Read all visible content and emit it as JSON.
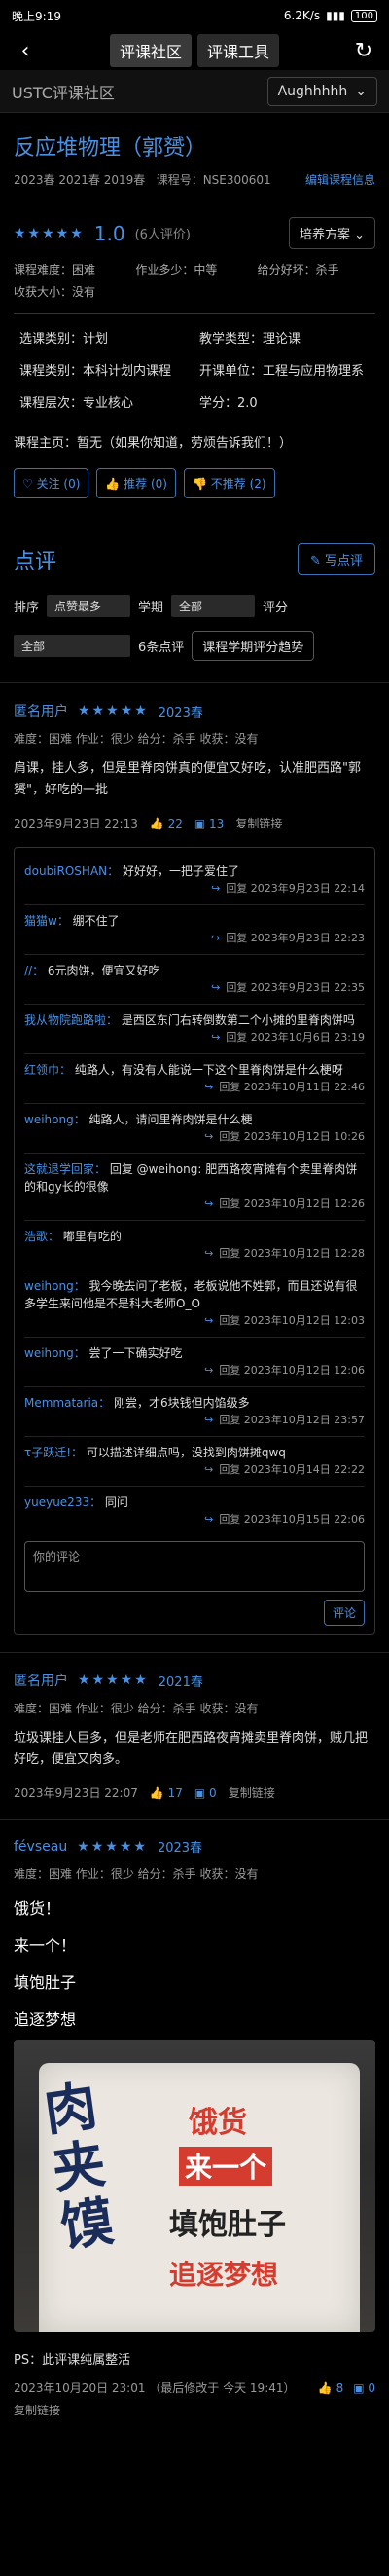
{
  "status": {
    "time": "晚上9:19",
    "speed": "6.2K/s",
    "battery": "100"
  },
  "nav": {
    "tabs": [
      "评课社区",
      "评课工具"
    ],
    "back": "‹",
    "refresh": "↻"
  },
  "site": {
    "title": "USTC评课社区",
    "user": "Aughhhhh"
  },
  "course": {
    "title": "反应堆物理（郭赟）",
    "terms": "2023春 2021春 2019春",
    "code": "课程号：NSE300601",
    "edit": "编辑课程信息",
    "stars": "★★★★★",
    "score": "1.0",
    "count": "(6人评价)",
    "plan": "培养方案",
    "info": [
      "课程难度：困难",
      "作业多少：中等",
      "给分好坏：杀手",
      "收获大小：没有"
    ],
    "details": [
      "选课类别：计划",
      "教学类型：理论课",
      "课程类别：本科计划内课程",
      "开课单位：工程与应用物理系",
      "课程层次：专业核心",
      "学分：2.0"
    ],
    "homepage": "课程主页：暂无（如果你知道，劳烦告诉我们！）",
    "actions": [
      "关注 (0)",
      "推荐 (0)",
      "不推荐 (2)"
    ]
  },
  "reviews_header": {
    "title": "点评",
    "write": "写点评",
    "sort_label": "排序",
    "sort_value": "点赞最多",
    "term_label": "学期",
    "term_value": "全部",
    "score_label": "评分",
    "score_value": "全部",
    "count": "6条点评",
    "trend": "课程学期评分趋势"
  },
  "reviews": [
    {
      "name": "匿名用户",
      "stars": "★★★★★",
      "semester": "2023春",
      "meta": "难度：困难   作业：很少   给分：杀手   收获：没有",
      "body": "肩课，挂人多，但是里脊肉饼真的便宜又好吃，认准肥西路\"郭赟\"，好吃的一批",
      "time": "2023年9月23日 22:13",
      "likes": "22",
      "comments_count": "13",
      "copy": "复制链接",
      "comments": [
        {
          "name": "doubiROSHAN：",
          "text": "好好好，一把子爱住了",
          "time": "回复 2023年9月23日 22:14"
        },
        {
          "name": "猫猫w：",
          "text": "绷不住了",
          "time": "回复 2023年9月23日 22:23"
        },
        {
          "name": "//：",
          "text": "6元肉饼，便宜又好吃",
          "time": "回复 2023年9月23日 22:35"
        },
        {
          "name": "我从物院跑路啦：",
          "text": "是西区东门右转倒数第二个小摊的里脊肉饼吗",
          "time": "回复 2023年10月6日 23:19"
        },
        {
          "name": "红领巾：",
          "text": "纯路人，有没有人能说一下这个里脊肉饼是什么梗呀",
          "time": "回复 2023年10月11日 22:46"
        },
        {
          "name": "weihong：",
          "text": "纯路人，请问里脊肉饼是什么梗",
          "time": "回复 2023年10月12日 10:26"
        },
        {
          "name": "这就退学回家：",
          "text": "回复 @weihong: 肥西路夜宵摊有个卖里脊肉饼的和gy长的很像",
          "time": "回复 2023年10月12日 12:26"
        },
        {
          "name": "浩歌：",
          "text": "嘟里有吃的",
          "time": "回复 2023年10月12日 12:28"
        },
        {
          "name": "weihong：",
          "text": "我今晚去问了老板，老板说他不姓郭，而且还说有很多学生来问他是不是科大老师O_O",
          "time": "回复 2023年10月12日 12:03"
        },
        {
          "name": "weihong：",
          "text": "尝了一下确实好吃",
          "time": "回复 2023年10月12日 12:06"
        },
        {
          "name": "Memmataria：",
          "text": "刚尝，才6块钱但内馅级多",
          "time": "回复 2023年10月12日 23:57"
        },
        {
          "name": "τ子跃迁!：",
          "text": "可以描述详细点吗，没找到肉饼摊qwq",
          "time": "回复 2023年10月14日 22:22"
        },
        {
          "name": "yueyue233：",
          "text": "同问",
          "time": "回复 2023年10月15日 22:06"
        }
      ],
      "input_placeholder": "你的评论",
      "submit": "评论"
    },
    {
      "name": "匿名用户",
      "stars": "★★★★★",
      "semester": "2021春",
      "meta": "难度：困难   作业：很少   给分：杀手   收获：没有",
      "body": "垃圾课挂人巨多，但是老师在肥西路夜宵摊卖里脊肉饼，贼几把好吃，便宜又肉多。",
      "time": "2023年9月23日 22:07",
      "likes": "17",
      "comments_count": "0",
      "copy": "复制链接"
    },
    {
      "name": "févseau",
      "stars": "★★★★★",
      "semester": "2023春",
      "meta": "难度：困难   作业：很少   给分：杀手   收获：没有",
      "lines": [
        "饿货！",
        "来一个！",
        "填饱肚子",
        "追逐梦想"
      ],
      "photo_text": [
        "饿货",
        "来一个",
        "填饱肚子",
        "追逐梦想"
      ],
      "ps": "PS：此评课纯属整活",
      "time": "2023年10月20日 23:01 （最后修改于 今天 19:41）",
      "likes": "8",
      "comments_count": "0",
      "copy": "复制链接"
    }
  ]
}
